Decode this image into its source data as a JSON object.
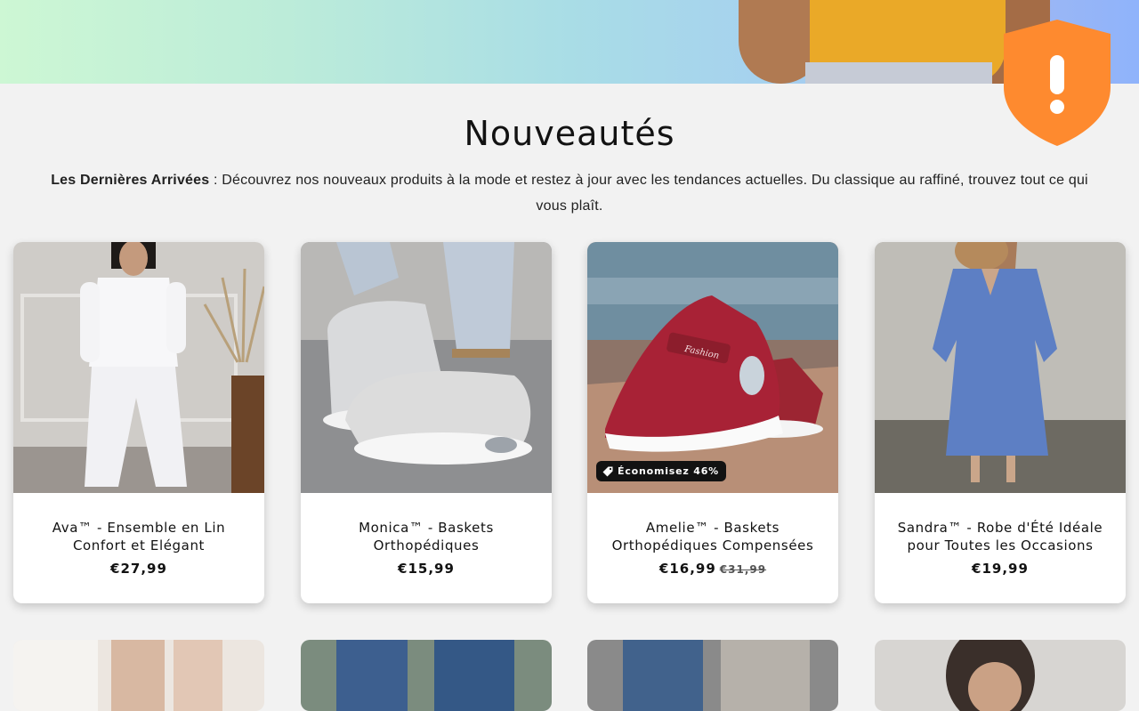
{
  "section": {
    "title": "Nouveautés",
    "desc_bold": "Les Dernières Arrivées",
    "desc_text": " : Découvrez nos nouveaux produits à la mode et restez à jour avec les tendances actuelles. Du classique au raffiné, trouvez tout ce qui vous plaît."
  },
  "products": [
    {
      "title": "Ava™ - Ensemble en Lin Confort et Elégant",
      "price": "€27,99",
      "image_icon": "white-linen-outfit-image"
    },
    {
      "title": "Monica™ - Baskets Orthopédiques",
      "price": "€15,99",
      "image_icon": "grey-sneakers-image"
    },
    {
      "title": "Amelie™ - Baskets Orthopédiques Compensées",
      "price": "€16,99",
      "compare_price": "€31,99",
      "badge": "Économisez 46%",
      "image_icon": "red-sneakers-image",
      "shoe_label": "Fashion"
    },
    {
      "title": "Sandra™ - Robe d'Été Idéale pour Toutes les Occasions",
      "price": "€19,99",
      "image_icon": "blue-dress-image"
    }
  ],
  "colors": {
    "accent_alert": "#fe8a2f",
    "badge_bg": "#121212",
    "card_bg": "#ffffff",
    "page_bg": "#f2f2f2"
  }
}
